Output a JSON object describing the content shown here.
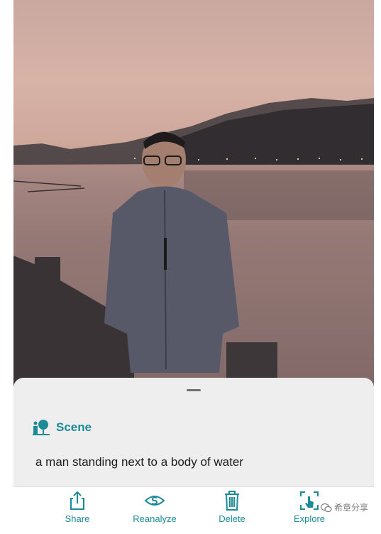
{
  "photo": {
    "alt": ""
  },
  "result": {
    "section_title": "Scene",
    "caption": "a man standing next to a body of water"
  },
  "toolbar": {
    "items": [
      {
        "label": "Share",
        "icon": "share-icon"
      },
      {
        "label": "Reanalyze",
        "icon": "eye-icon"
      },
      {
        "label": "Delete",
        "icon": "trash-icon"
      },
      {
        "label": "Explore",
        "icon": "explore-icon"
      }
    ]
  },
  "watermark": {
    "text": "希章分享"
  },
  "colors": {
    "accent": "#1b8b96",
    "sheet": "#eeeeee"
  }
}
